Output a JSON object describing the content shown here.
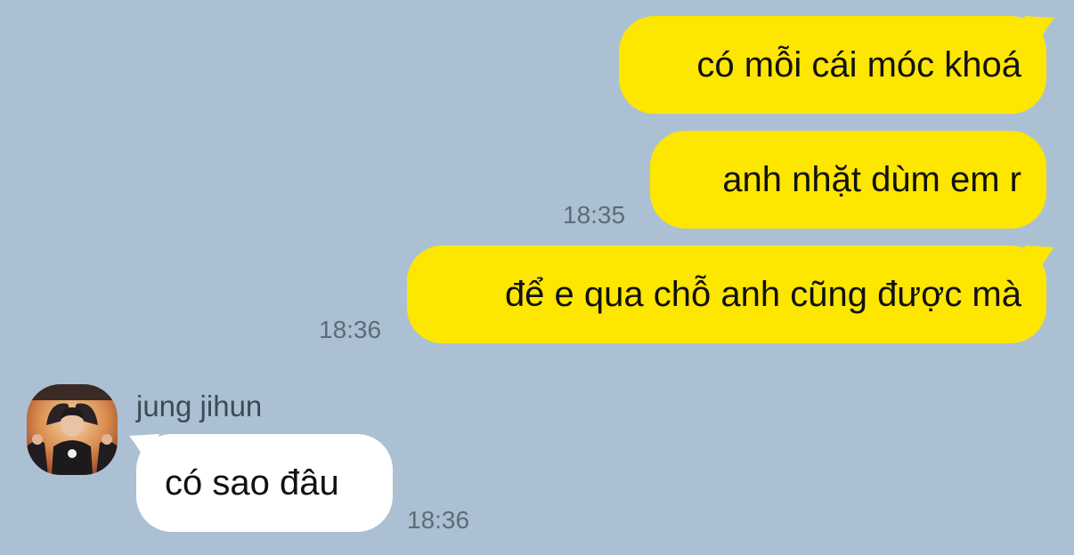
{
  "colors": {
    "background": "#abc1d3",
    "sent_bubble": "#fde600",
    "received_bubble": "#ffffff",
    "timestamp_text": "#5f6b76",
    "sender_name_text": "#3f4a54"
  },
  "messages": [
    {
      "direction": "sent",
      "text": "có mỗi cái móc khoá"
    },
    {
      "direction": "sent",
      "text": "anh nhặt dùm em r",
      "time": "18:35"
    },
    {
      "direction": "sent",
      "text": "để e qua chỗ anh cũng được mà",
      "time": "18:36"
    },
    {
      "direction": "received",
      "sender": "jung jihun",
      "text": "có sao đâu",
      "time": "18:36"
    }
  ],
  "icons": {
    "avatar": "profile-photo-avatar"
  }
}
